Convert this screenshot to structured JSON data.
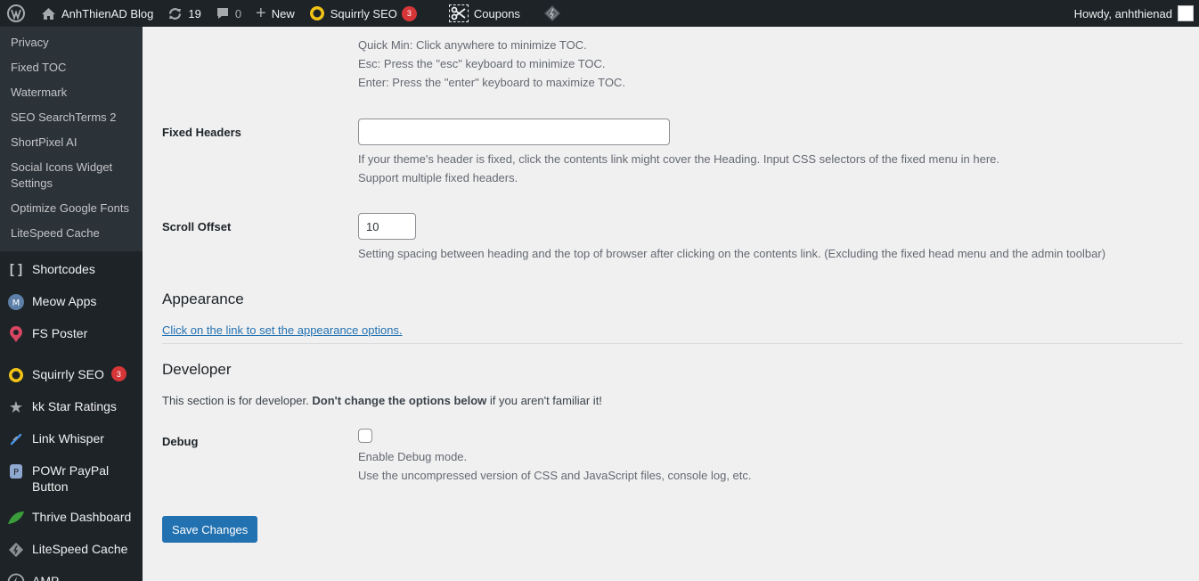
{
  "adminbar": {
    "site_name": "AnhThienAD Blog",
    "updates_count": "19",
    "comments_count": "0",
    "new_label": "New",
    "squirrly_label": "Squirrly SEO",
    "squirrly_badge": "3",
    "coupons_label": "Coupons",
    "howdy_label": "Howdy, anhthienad"
  },
  "sidebar": {
    "submenu": [
      {
        "label": "Privacy"
      },
      {
        "label": "Fixed TOC"
      },
      {
        "label": "Watermark"
      },
      {
        "label": "SEO SearchTerms 2"
      },
      {
        "label": "ShortPixel AI"
      },
      {
        "label": "Social Icons Widget Settings"
      },
      {
        "label": "Optimize Google Fonts"
      },
      {
        "label": "LiteSpeed Cache"
      }
    ],
    "menu": [
      {
        "label": "Shortcodes",
        "icon": "brackets-icon"
      },
      {
        "label": "Meow Apps",
        "icon": "meow-apps-icon"
      },
      {
        "label": "FS Poster",
        "icon": "fs-poster-icon"
      },
      {
        "label": "Squirrly SEO",
        "icon": "squirrly-icon",
        "badge": "3"
      },
      {
        "label": "kk Star Ratings",
        "icon": "star-icon"
      },
      {
        "label": "Link Whisper",
        "icon": "link-whisper-icon"
      },
      {
        "label": "POWr PayPal Button",
        "icon": "powr-icon"
      },
      {
        "label": "Thrive Dashboard",
        "icon": "leaf-icon"
      },
      {
        "label": "LiteSpeed Cache",
        "icon": "litespeed-icon"
      },
      {
        "label": "AMP",
        "icon": "amp-icon"
      }
    ]
  },
  "content": {
    "toc_help": {
      "quick_min": "Quick Min: Click anywhere to minimize TOC.",
      "esc": "Esc: Press the \"esc\" keyboard to minimize TOC.",
      "enter": "Enter: Press the \"enter\" keyboard to maximize TOC."
    },
    "fixed_headers": {
      "label": "Fixed Headers",
      "value": "",
      "desc1": "If your theme's header is fixed, click the contents link might cover the Heading. Input CSS selectors of the fixed menu in here.",
      "desc2": "Support multiple fixed headers."
    },
    "scroll_offset": {
      "label": "Scroll Offset",
      "value": "10",
      "desc": "Setting spacing between heading and the top of browser after clicking on the contents link. (Excluding the fixed head menu and the admin toolbar)"
    },
    "appearance": {
      "title": "Appearance",
      "link": "Click on the link to set the appearance options."
    },
    "developer": {
      "title": "Developer",
      "intro_pre": "This section is for developer. ",
      "intro_bold": "Don't change the options below",
      "intro_post": " if you aren't familiar it!"
    },
    "debug": {
      "label": "Debug",
      "checked": false,
      "desc1": "Enable Debug mode.",
      "desc2": "Use the uncompressed version of CSS and JavaScript files, console log, etc."
    },
    "save_button": "Save Changes"
  }
}
